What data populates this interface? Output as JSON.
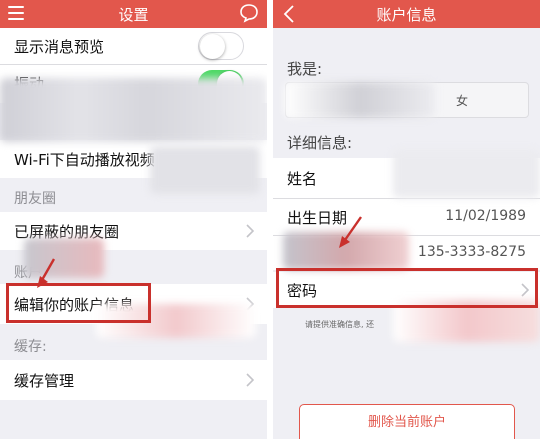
{
  "left": {
    "nav_title": "设置",
    "items": {
      "message_preview": "显示消息预览",
      "vibrate": "振动",
      "wifi_autoplay": "Wi-Fi下自动播放视频",
      "blocked_moments": "已屏蔽的朋友圈",
      "edit_account": "编辑你的账户信息",
      "cache_manage": "缓存管理"
    },
    "sections": {
      "moments": "朋友圈",
      "account": "账户",
      "cache": "缓存:"
    },
    "switches": {
      "message_preview_on": false,
      "vibrate_on": true
    }
  },
  "right": {
    "nav_title": "账户信息",
    "section_iam": "我是:",
    "gender_female": "女",
    "section_details": "详细信息:",
    "name_label": "姓名",
    "birthday_label": "出生日期",
    "birthday_value": "11/02/1989",
    "phone_value": "135-3333-8275",
    "password_label": "密码",
    "hint": "请提供准确信息, 还",
    "delete_label": "删除当前账户"
  },
  "colors": {
    "brand": "#e2574c",
    "switch_on": "#4cd964",
    "highlight": "#c9302c"
  }
}
